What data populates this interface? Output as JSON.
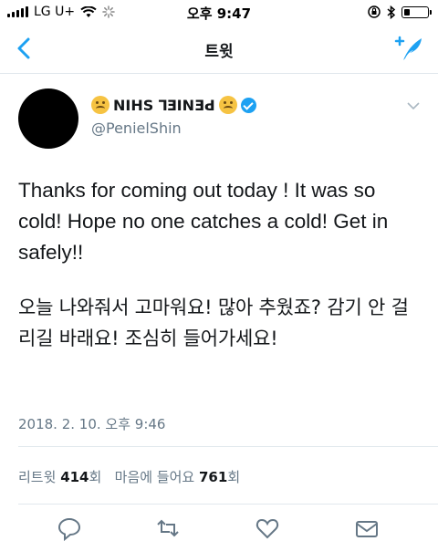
{
  "status_bar": {
    "carrier": "LG U+",
    "time": "오후 9:47",
    "battery_level": 0.25
  },
  "nav": {
    "title": "트윗",
    "back_icon": "chevron-left-icon",
    "compose_icon": "compose-tweet-icon"
  },
  "tweet": {
    "display_name": "NIHS ꓶƎIN",
    "display_name_chars": [
      "N",
      "I",
      "H",
      "S",
      " ",
      "ꓶ",
      "Ǝ",
      "I",
      "N",
      "Ǝ",
      "ꓒ"
    ],
    "handle": "@PenielShin",
    "text_en": "Thanks for coming out today ! It was so cold! Hope no one catches a cold! Get in safely!!",
    "text_ko": "오늘 나와줘서 고마워요! 많아 추웠죠? 감기 안 걸리길 바래요! 조심히 들어가세요!",
    "timestamp": "2018. 2. 10. 오후 9:46",
    "stats": {
      "retweet_label": "리트윗",
      "retweet_count": "414",
      "retweet_unit": "회",
      "like_label": "마음에 들어요",
      "like_count": "761",
      "like_unit": "회"
    }
  },
  "actions": [
    "reply-icon",
    "retweet-icon",
    "like-icon",
    "share-icon"
  ],
  "colors": {
    "accent": "#1da1f2",
    "secondary_text": "#657786",
    "divider": "#e1e8ed"
  }
}
